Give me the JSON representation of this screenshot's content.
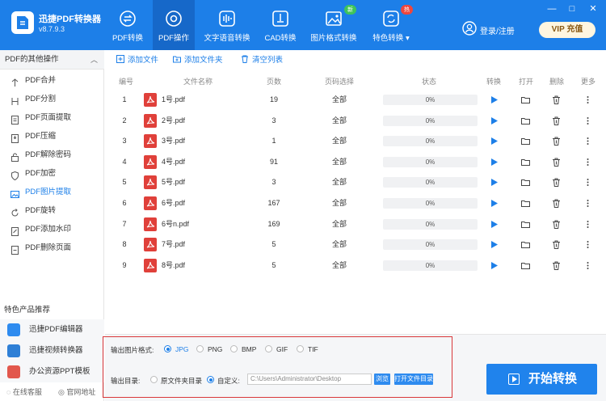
{
  "app": {
    "name": "迅捷PDF转换器",
    "version": "v8.7.9.3"
  },
  "nav": [
    {
      "label": "PDF转换",
      "icon": "convert-icon"
    },
    {
      "label": "PDF操作",
      "icon": "gear-icon"
    },
    {
      "label": "文字语音转换",
      "icon": "audio-wave-icon"
    },
    {
      "label": "CAD转换",
      "icon": "cad-icon"
    },
    {
      "label": "图片格式转换",
      "icon": "image-icon",
      "badge": "新"
    },
    {
      "label": "特色转换",
      "icon": "special-convert-icon",
      "badge": "热"
    }
  ],
  "window_controls": {
    "minimize": "—",
    "maximize": "□",
    "close": "✕"
  },
  "account": {
    "login_label": "登录/注册",
    "vip_label": "VIP 充值"
  },
  "sidebar": {
    "header": "PDF的其他操作",
    "items": [
      {
        "label": "PDF合并",
        "icon": "merge-icon"
      },
      {
        "label": "PDF分割",
        "icon": "split-icon"
      },
      {
        "label": "PDF页面提取",
        "icon": "extract-page-icon"
      },
      {
        "label": "PDF压缩",
        "icon": "compress-icon"
      },
      {
        "label": "PDF解除密码",
        "icon": "unlock-icon"
      },
      {
        "label": "PDF加密",
        "icon": "shield-icon"
      },
      {
        "label": "PDF图片提取",
        "icon": "image-extract-icon",
        "active": true
      },
      {
        "label": "PDF旋转",
        "icon": "rotate-icon"
      },
      {
        "label": "PDF添加水印",
        "icon": "watermark-icon"
      },
      {
        "label": "PDF删除页面",
        "icon": "delete-page-icon"
      }
    ],
    "recommend_title": "特色产品推荐",
    "recommend": [
      {
        "label": "迅捷PDF编辑器",
        "color": "#2e8bef"
      },
      {
        "label": "迅捷视频转换器",
        "color": "#2e7fd6"
      },
      {
        "label": "办公资源PPT模板",
        "color": "#e2574c"
      }
    ],
    "footer": {
      "service": "在线客服",
      "website": "官网地址"
    }
  },
  "toolbar": {
    "add_file": "添加文件",
    "add_folder": "添加文件夹",
    "clear_list": "清空列表"
  },
  "table": {
    "headers": [
      "编号",
      "文件名称",
      "页数",
      "页码选择",
      "状态",
      "转换",
      "打开",
      "删除",
      "更多"
    ],
    "rows": [
      {
        "no": "1",
        "name": "1号.pdf",
        "pages": "19",
        "range": "全部",
        "status": "0%"
      },
      {
        "no": "2",
        "name": "2号.pdf",
        "pages": "3",
        "range": "全部",
        "status": "0%"
      },
      {
        "no": "3",
        "name": "3号.pdf",
        "pages": "1",
        "range": "全部",
        "status": "0%"
      },
      {
        "no": "4",
        "name": "4号.pdf",
        "pages": "91",
        "range": "全部",
        "status": "0%"
      },
      {
        "no": "5",
        "name": "5号.pdf",
        "pages": "3",
        "range": "全部",
        "status": "0%"
      },
      {
        "no": "6",
        "name": "6号.pdf",
        "pages": "167",
        "range": "全部",
        "status": "0%"
      },
      {
        "no": "7",
        "name": "6号n.pdf",
        "pages": "169",
        "range": "全部",
        "status": "0%"
      },
      {
        "no": "8",
        "name": "7号.pdf",
        "pages": "5",
        "range": "全部",
        "status": "0%"
      },
      {
        "no": "9",
        "name": "8号.pdf",
        "pages": "5",
        "range": "全部",
        "status": "0%"
      }
    ]
  },
  "output": {
    "format_label": "输出图片格式:",
    "formats": [
      "JPG",
      "PNG",
      "BMP",
      "GIF",
      "TIF"
    ],
    "selected_format": "JPG",
    "dir_label": "输出目录:",
    "dir_option_source": "原文件夹目录",
    "dir_option_custom": "自定义:",
    "path_value": "C:\\Users\\Administrator\\Desktop",
    "browse_label": "浏览",
    "open_dir_label": "打开文件目录"
  },
  "start_button": "开始转换",
  "colors": {
    "brand": "#1d7fe8",
    "highlight": "#d9383a",
    "pdf_icon": "#e0403a"
  }
}
